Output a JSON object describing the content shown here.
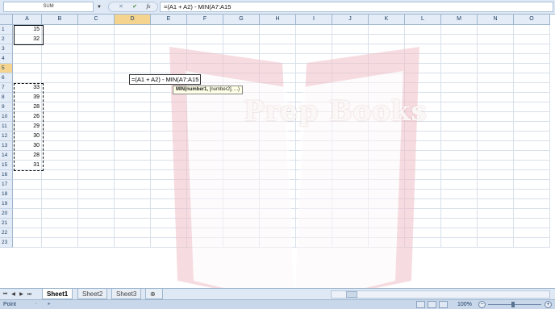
{
  "formula_bar": {
    "name_box": "SUM",
    "cancel_icon": "cancel-x-icon",
    "enter_icon": "checkmark-icon",
    "fx_label": "fx",
    "formula": "=(A1 + A2) - MIN(A7:A15"
  },
  "columns": [
    "A",
    "B",
    "C",
    "D",
    "E",
    "F",
    "G",
    "H",
    "I",
    "J",
    "K",
    "L",
    "M",
    "N",
    "O"
  ],
  "rows": [
    "1",
    "2",
    "3",
    "4",
    "5",
    "6",
    "7",
    "8",
    "9",
    "10",
    "11",
    "12",
    "13",
    "14",
    "15",
    "16",
    "17",
    "18",
    "19",
    "20",
    "21",
    "22",
    "23"
  ],
  "cells": {
    "A1": "15",
    "A2": "32",
    "A7": "33",
    "A8": "39",
    "A9": "28",
    "A10": "26",
    "A11": "29",
    "A12": "30",
    "A13": "30",
    "A14": "28",
    "A15": "31"
  },
  "edit_cell": {
    "text": "=(A1 + A2) - MIN(A7:A15",
    "tooltip_fn": "MIN(number1,",
    "tooltip_rest": " [number2], ...)"
  },
  "watermark": {
    "text": "Prep Books"
  },
  "sheet_tabs": [
    "Sheet1",
    "Sheet2",
    "Sheet3"
  ],
  "status_bar": {
    "mode": "Point",
    "zoom": "100%",
    "zoom_minus": "−",
    "zoom_plus": "+"
  },
  "colors": {
    "header_bg": "#e4ecf7",
    "active_header": "#f4d48e",
    "status_bg": "#c9d7ea"
  }
}
